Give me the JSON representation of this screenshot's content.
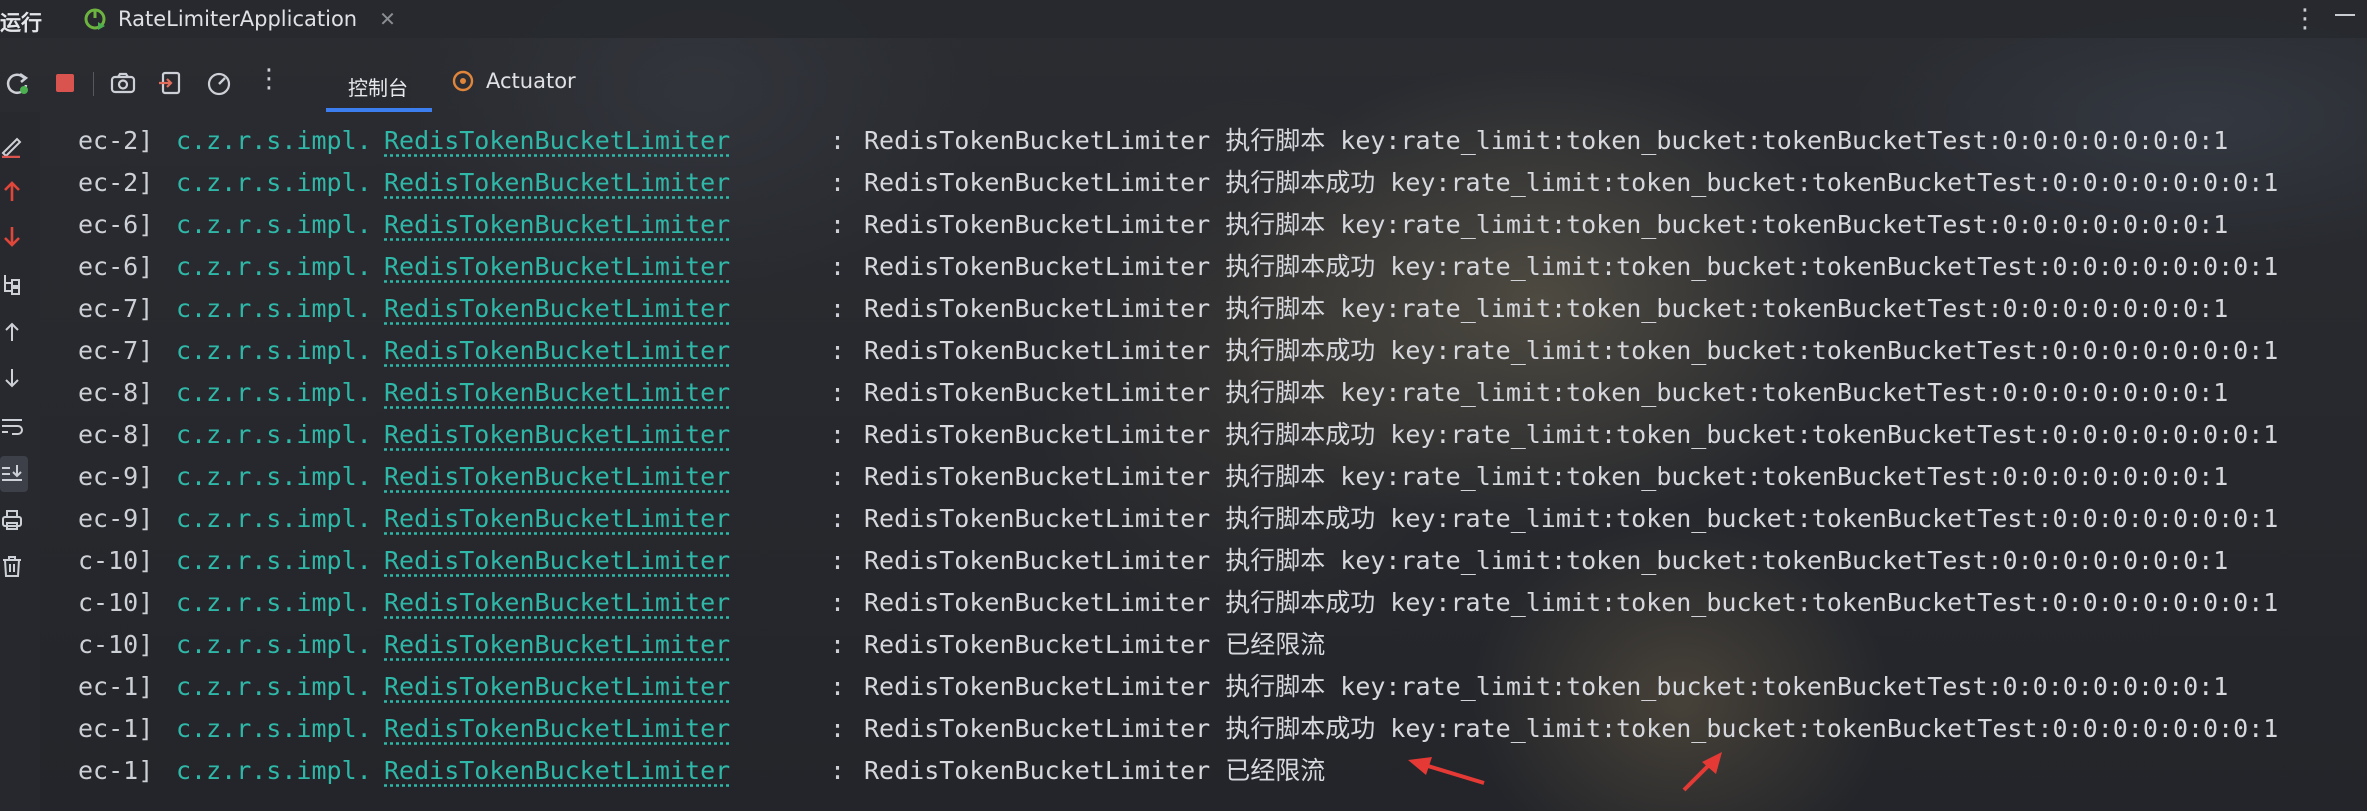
{
  "titlebar": {
    "run_label": "运行",
    "tab_title": "RateLimiterApplication",
    "close_glyph": "✕",
    "menu_glyph": "⋮"
  },
  "toolbar": {
    "icons": [
      "rerun-icon",
      "stop-icon",
      "camera-icon",
      "exit-icon",
      "gauge-icon",
      "more-icon"
    ],
    "more_glyph": "⋮"
  },
  "tabs": [
    {
      "label": "控制台",
      "active": true
    },
    {
      "label": "Actuator",
      "active": false
    }
  ],
  "gutter_icons": [
    "clear-icon",
    "up-red-icon",
    "down-red-icon",
    "tree-icon",
    "scroll-up-icon",
    "scroll-down-icon",
    "wrap-icon",
    "scroll-end-icon",
    "print-icon",
    "trash-icon"
  ],
  "colors": {
    "accent": "#3c7df0",
    "class_link": "#2fb8a8",
    "stop": "#d9534f",
    "annotation_arrow": "#e53935"
  },
  "log_lines": [
    {
      "thread": "ec-2]",
      "pkg": "c.z.r.s.impl.",
      "cls": "RedisTokenBucketLimiter",
      "sep": ":",
      "msg": "RedisTokenBucketLimiter 执行脚本 key:rate_limit:token_bucket:tokenBucketTest:0:0:0:0:0:0:0:1"
    },
    {
      "thread": "ec-2]",
      "pkg": "c.z.r.s.impl.",
      "cls": "RedisTokenBucketLimiter",
      "sep": ":",
      "msg": "RedisTokenBucketLimiter 执行脚本成功 key:rate_limit:token_bucket:tokenBucketTest:0:0:0:0:0:0:0:1"
    },
    {
      "thread": "ec-6]",
      "pkg": "c.z.r.s.impl.",
      "cls": "RedisTokenBucketLimiter",
      "sep": ":",
      "msg": "RedisTokenBucketLimiter 执行脚本 key:rate_limit:token_bucket:tokenBucketTest:0:0:0:0:0:0:0:1"
    },
    {
      "thread": "ec-6]",
      "pkg": "c.z.r.s.impl.",
      "cls": "RedisTokenBucketLimiter",
      "sep": ":",
      "msg": "RedisTokenBucketLimiter 执行脚本成功 key:rate_limit:token_bucket:tokenBucketTest:0:0:0:0:0:0:0:1"
    },
    {
      "thread": "ec-7]",
      "pkg": "c.z.r.s.impl.",
      "cls": "RedisTokenBucketLimiter",
      "sep": ":",
      "msg": "RedisTokenBucketLimiter 执行脚本 key:rate_limit:token_bucket:tokenBucketTest:0:0:0:0:0:0:0:1"
    },
    {
      "thread": "ec-7]",
      "pkg": "c.z.r.s.impl.",
      "cls": "RedisTokenBucketLimiter",
      "sep": ":",
      "msg": "RedisTokenBucketLimiter 执行脚本成功 key:rate_limit:token_bucket:tokenBucketTest:0:0:0:0:0:0:0:1"
    },
    {
      "thread": "ec-8]",
      "pkg": "c.z.r.s.impl.",
      "cls": "RedisTokenBucketLimiter",
      "sep": ":",
      "msg": "RedisTokenBucketLimiter 执行脚本 key:rate_limit:token_bucket:tokenBucketTest:0:0:0:0:0:0:0:1"
    },
    {
      "thread": "ec-8]",
      "pkg": "c.z.r.s.impl.",
      "cls": "RedisTokenBucketLimiter",
      "sep": ":",
      "msg": "RedisTokenBucketLimiter 执行脚本成功 key:rate_limit:token_bucket:tokenBucketTest:0:0:0:0:0:0:0:1"
    },
    {
      "thread": "ec-9]",
      "pkg": "c.z.r.s.impl.",
      "cls": "RedisTokenBucketLimiter",
      "sep": ":",
      "msg": "RedisTokenBucketLimiter 执行脚本 key:rate_limit:token_bucket:tokenBucketTest:0:0:0:0:0:0:0:1"
    },
    {
      "thread": "ec-9]",
      "pkg": "c.z.r.s.impl.",
      "cls": "RedisTokenBucketLimiter",
      "sep": ":",
      "msg": "RedisTokenBucketLimiter 执行脚本成功 key:rate_limit:token_bucket:tokenBucketTest:0:0:0:0:0:0:0:1"
    },
    {
      "thread": "c-10]",
      "pkg": "c.z.r.s.impl.",
      "cls": "RedisTokenBucketLimiter",
      "sep": ":",
      "msg": "RedisTokenBucketLimiter 执行脚本 key:rate_limit:token_bucket:tokenBucketTest:0:0:0:0:0:0:0:1"
    },
    {
      "thread": "c-10]",
      "pkg": "c.z.r.s.impl.",
      "cls": "RedisTokenBucketLimiter",
      "sep": ":",
      "msg": "RedisTokenBucketLimiter 执行脚本成功 key:rate_limit:token_bucket:tokenBucketTest:0:0:0:0:0:0:0:1"
    },
    {
      "thread": "c-10]",
      "pkg": "c.z.r.s.impl.",
      "cls": "RedisTokenBucketLimiter",
      "sep": ":",
      "msg": "RedisTokenBucketLimiter 已经限流"
    },
    {
      "thread": "ec-1]",
      "pkg": "c.z.r.s.impl.",
      "cls": "RedisTokenBucketLimiter",
      "sep": ":",
      "msg": "RedisTokenBucketLimiter 执行脚本 key:rate_limit:token_bucket:tokenBucketTest:0:0:0:0:0:0:0:1"
    },
    {
      "thread": "ec-1]",
      "pkg": "c.z.r.s.impl.",
      "cls": "RedisTokenBucketLimiter",
      "sep": ":",
      "msg": "RedisTokenBucketLimiter 执行脚本成功 key:rate_limit:token_bucket:tokenBucketTest:0:0:0:0:0:0:0:1"
    },
    {
      "thread": "ec-1]",
      "pkg": "c.z.r.s.impl.",
      "cls": "RedisTokenBucketLimiter",
      "sep": ":",
      "msg": "RedisTokenBucketLimiter 已经限流"
    }
  ]
}
